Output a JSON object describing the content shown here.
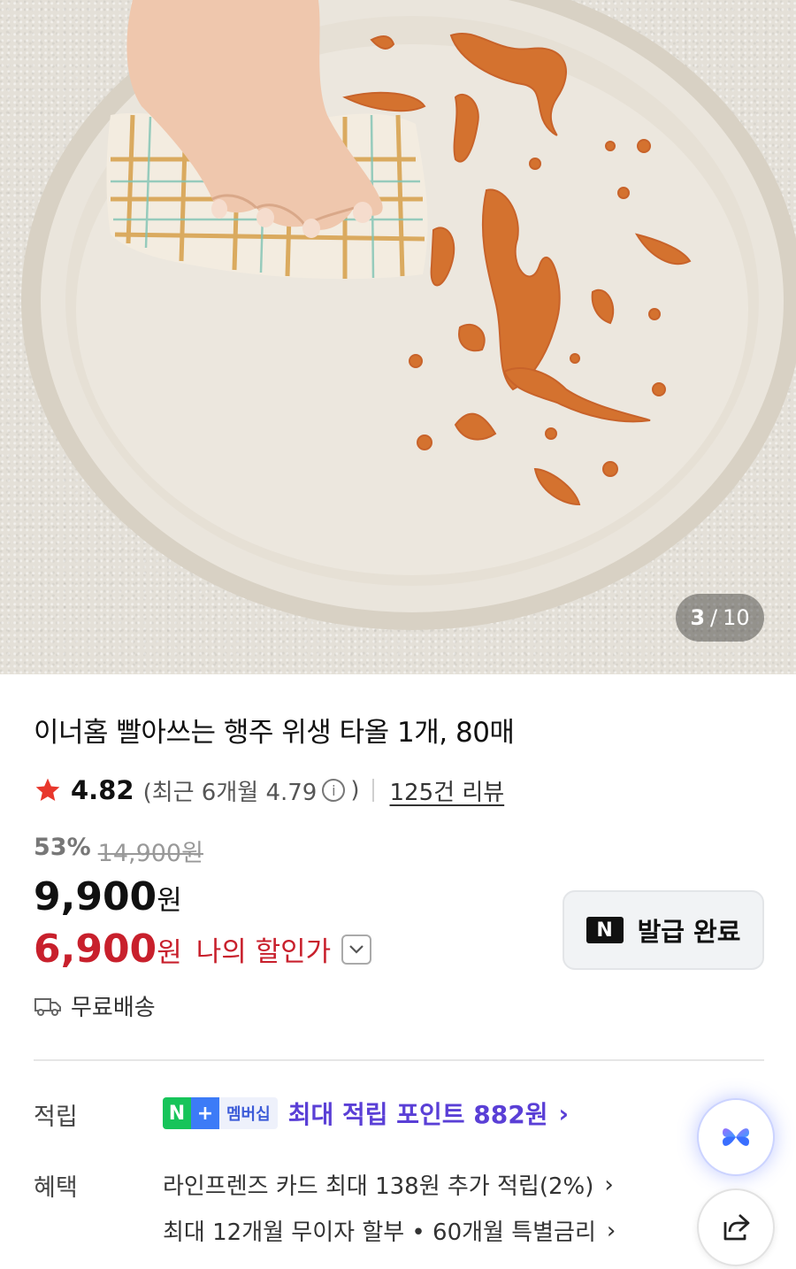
{
  "gallery": {
    "current": "3",
    "separator": "/",
    "total": "10"
  },
  "product": {
    "title": "이너홈 빨아쓰는 행주 위생 타올 1개, 80매"
  },
  "rating": {
    "score": "4.82",
    "recent": "(최근 6개월 4.79",
    "recent_close": ")",
    "info_glyph": "i",
    "reviews": "125건 리뷰"
  },
  "price": {
    "discount_rate": "53%",
    "original": "14,900원",
    "sale": "9,900",
    "sale_unit": "원",
    "my_price": "6,900",
    "my_price_unit": "원",
    "my_price_label": "나의 할인가"
  },
  "coupon": {
    "logo": "N",
    "label": "발급 완료"
  },
  "shipping": {
    "label": "무료배송"
  },
  "points": {
    "label": "적립",
    "badge_n": "N",
    "badge_plus": "+",
    "badge_membership": "멤버십",
    "text": "최대 적립 포인트 882원",
    "chevron": "›"
  },
  "benefits": {
    "label": "혜택",
    "lines": [
      "라인프렌즈 카드 최대 138원 추가 적립(2%)",
      "최대 12개월 무이자 할부 • 60개월 특별금리"
    ],
    "chevron": "›"
  },
  "colors": {
    "accent_red": "#c8202c",
    "points_purple": "#5a3fd6",
    "star": "#e8372c",
    "naver_green": "#17c45a"
  },
  "icons": [
    "star-icon",
    "info-icon",
    "chevron-down-icon",
    "truck-icon",
    "ai-assistant-icon",
    "share-icon"
  ]
}
